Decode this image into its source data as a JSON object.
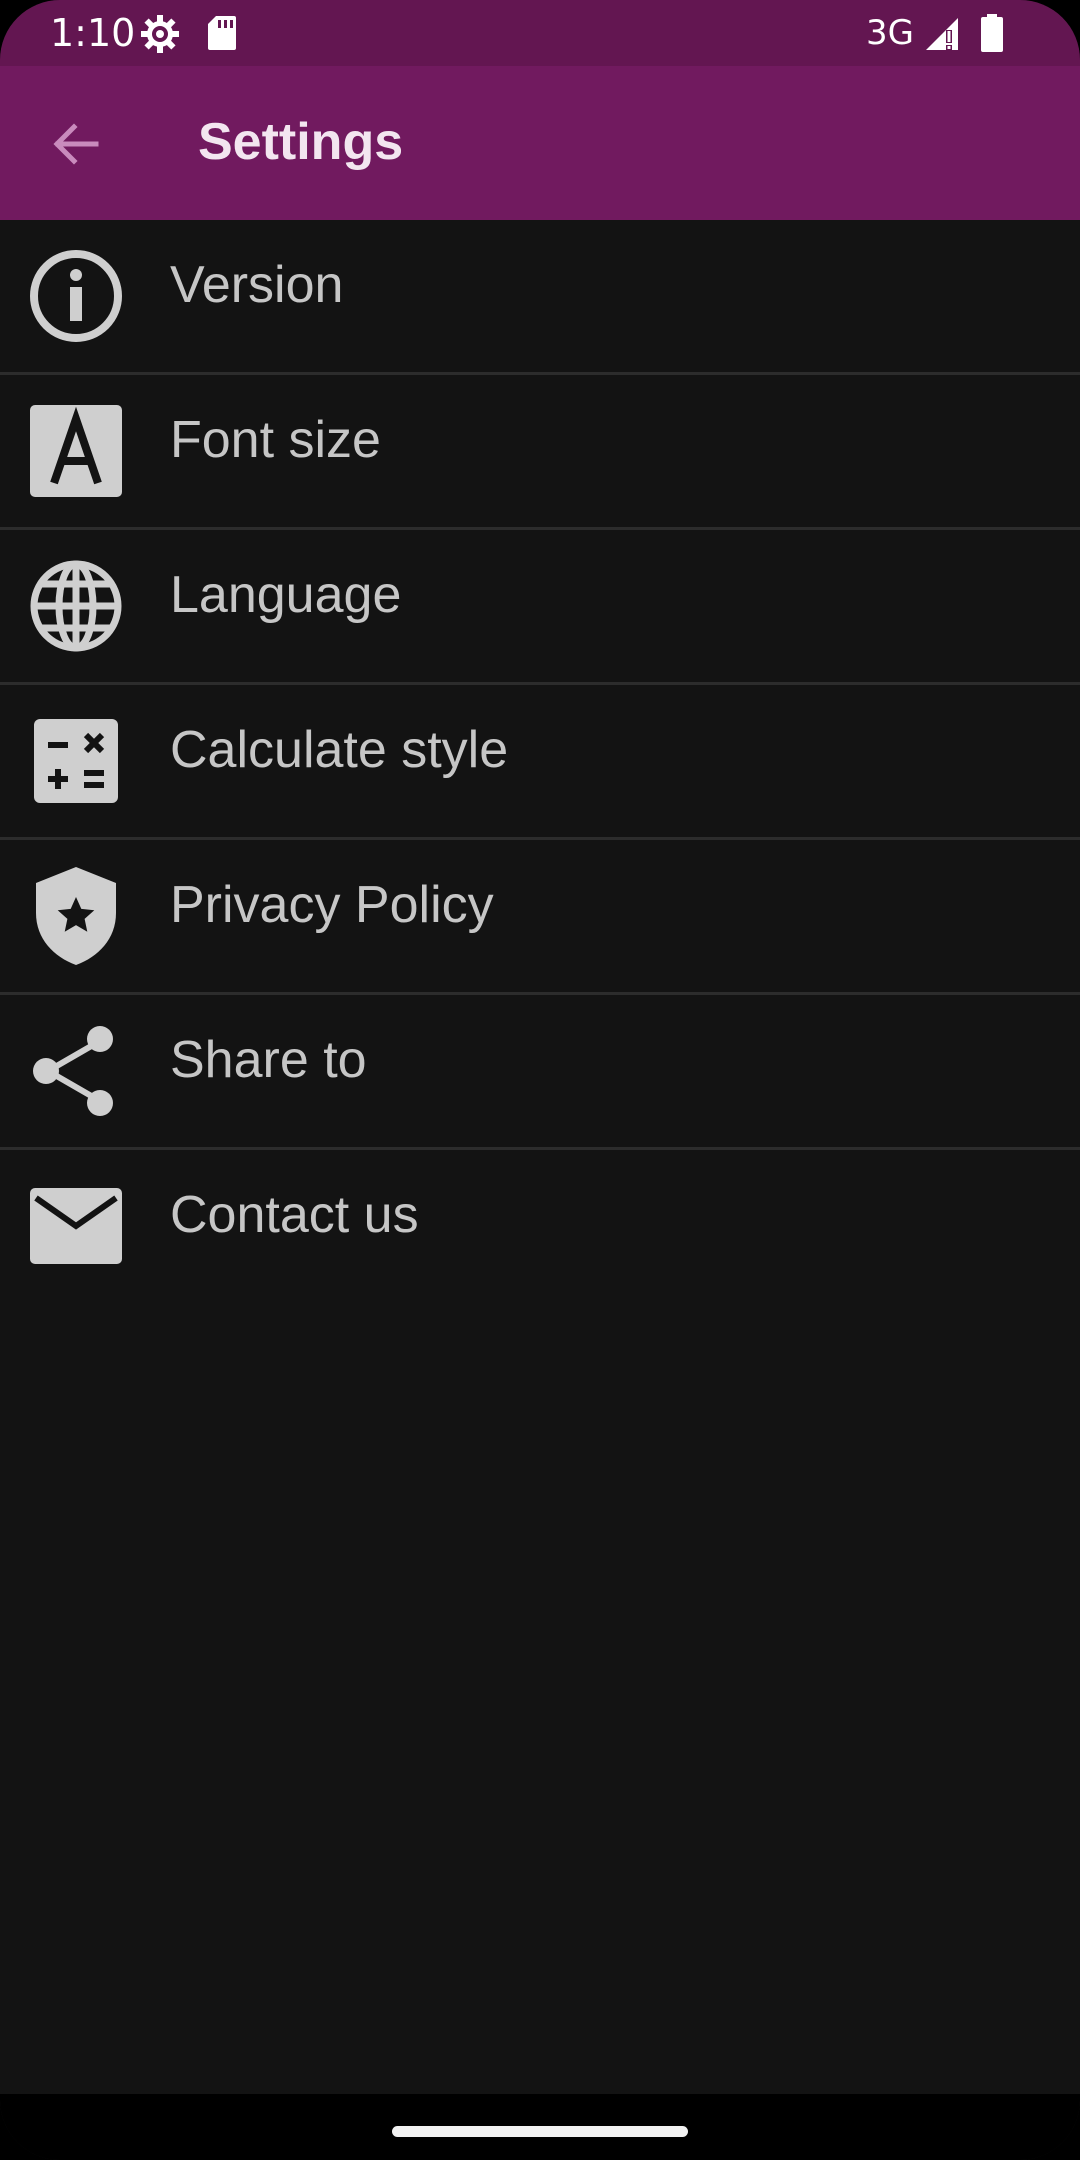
{
  "status_bar": {
    "time": "1:10",
    "network": "3G"
  },
  "app_bar": {
    "title": "Settings"
  },
  "settings": {
    "items": [
      {
        "label": "Version",
        "icon": "info-icon"
      },
      {
        "label": "Font size",
        "icon": "font-size-icon"
      },
      {
        "label": "Language",
        "icon": "globe-icon"
      },
      {
        "label": "Calculate style",
        "icon": "calculator-icon"
      },
      {
        "label": "Privacy Policy",
        "icon": "shield-star-icon"
      },
      {
        "label": "Share to",
        "icon": "share-icon"
      },
      {
        "label": "Contact us",
        "icon": "mail-icon"
      }
    ]
  },
  "colors": {
    "status_bar": "#631651",
    "app_bar": "#711a5f",
    "background": "#131313",
    "icon": "#cfcfcf",
    "label": "#c6c6c6"
  }
}
